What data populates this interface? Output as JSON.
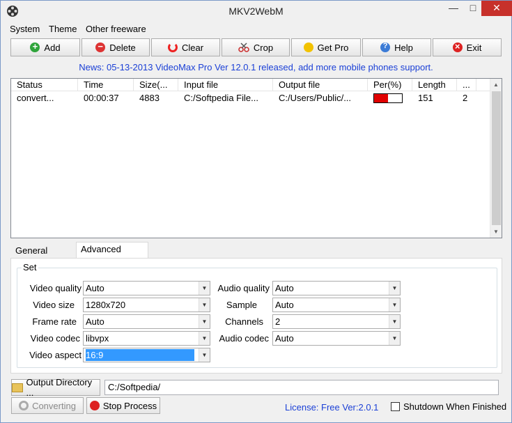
{
  "window": {
    "title": "MKV2WebM"
  },
  "menu": [
    "System",
    "Theme",
    "Other freeware"
  ],
  "toolbar": {
    "add": "Add",
    "delete": "Delete",
    "clear": "Clear",
    "crop": "Crop",
    "get_pro": "Get Pro",
    "help": "Help",
    "exit": "Exit"
  },
  "news": "News: 05-13-2013 VideoMax Pro Ver 12.0.1 released, add more mobile phones support.",
  "table": {
    "columns": [
      "Status",
      "Time",
      "Size(...",
      "Input file",
      "Output file",
      "Per(%)",
      "Length",
      "..."
    ],
    "rows": [
      {
        "status": "convert...",
        "time": "00:00:37",
        "size": "4883",
        "input": "C:/Softpedia File...",
        "output": "C:/Users/Public/...",
        "percent": 0.5,
        "length": "151",
        "extra": "2"
      }
    ]
  },
  "tabs": [
    "General Option",
    "Advanced Option"
  ],
  "active_tab": "Advanced Option",
  "settings": {
    "group_label": "Set",
    "video_quality": {
      "label": "Video quality",
      "value": "Auto"
    },
    "video_size": {
      "label": "Video size",
      "value": "1280x720"
    },
    "frame_rate": {
      "label": "Frame rate",
      "value": "Auto"
    },
    "video_codec": {
      "label": "Video codec",
      "value": "libvpx"
    },
    "video_aspect": {
      "label": "Video aspect",
      "value": "16:9"
    },
    "audio_quality": {
      "label": "Audio quality",
      "value": "Auto"
    },
    "sample": {
      "label": "Sample",
      "value": "Auto"
    },
    "channels": {
      "label": "Channels",
      "value": "2"
    },
    "audio_codec": {
      "label": "Audio codec",
      "value": "Auto"
    }
  },
  "output": {
    "button": "Output Directory ...",
    "path": "C:/Softpedia/"
  },
  "actions": {
    "converting": "Converting",
    "stop": "Stop Process"
  },
  "footer": {
    "license": "License: Free Ver:2.0.1",
    "shutdown": "Shutdown When Finished"
  },
  "colors": {
    "news": "#1a3fd6",
    "progress": "#e00000",
    "selection": "#3399ff",
    "close": "#c7312b"
  }
}
